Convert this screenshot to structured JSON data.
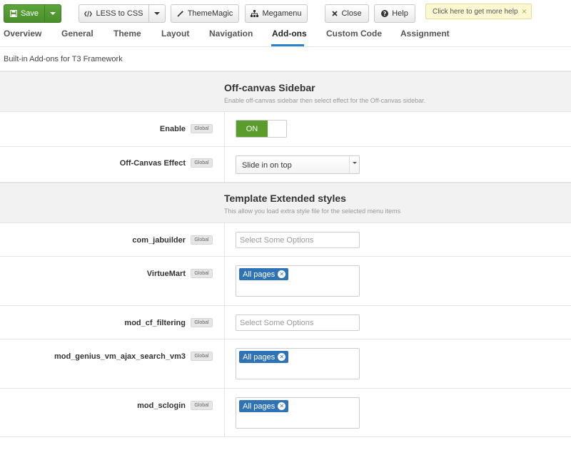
{
  "toolbar": {
    "save_label": "Save",
    "less_label": "LESS to CSS",
    "thememagic_label": "ThemeMagic",
    "megamenu_label": "Megamenu",
    "close_label": "Close",
    "help_label": "Help",
    "help_tip": "Click here to get more help",
    "tip_close": "×"
  },
  "tabs": {
    "overview": "Overview",
    "general": "General",
    "theme": "Theme",
    "layout": "Layout",
    "navigation": "Navigation",
    "addons": "Add-ons",
    "custom_code": "Custom Code",
    "assignment": "Assignment"
  },
  "page": {
    "subtitle": "Built-in Add-ons for T3 Framework"
  },
  "offcanvas": {
    "title": "Off-canvas Sidebar",
    "description": "Enable off-canvas sidebar then select effect for the Off-canvas sidebar.",
    "enable_label": "Enable",
    "enable_badge": "Global",
    "enable_value": "ON",
    "effect_label": "Off-Canvas Effect",
    "effect_badge": "Global",
    "effect_value": "Slide in on top"
  },
  "extended": {
    "title": "Template Extended styles",
    "description": "This allow you load extra style file for the selected menu items",
    "rows": [
      {
        "label": "com_jabuilder",
        "badge": "Global",
        "placeholder": "Select Some Options",
        "chip": ""
      },
      {
        "label": "VirtueMart",
        "badge": "Global",
        "placeholder": "",
        "chip": "All pages"
      },
      {
        "label": "mod_cf_filtering",
        "badge": "Global",
        "placeholder": "Select Some Options",
        "chip": ""
      },
      {
        "label": "mod_genius_vm_ajax_search_vm3",
        "badge": "Global",
        "placeholder": "",
        "chip": "All pages"
      },
      {
        "label": "mod_sclogin",
        "badge": "Global",
        "placeholder": "",
        "chip": "All pages"
      }
    ]
  },
  "colors": {
    "save_green": "#4a8f2c",
    "toggle_green": "#5a9d2d",
    "chip_blue": "#2f73b7",
    "tab_active_underline": "#2a83c6",
    "tip_background": "#fcf8d2"
  }
}
